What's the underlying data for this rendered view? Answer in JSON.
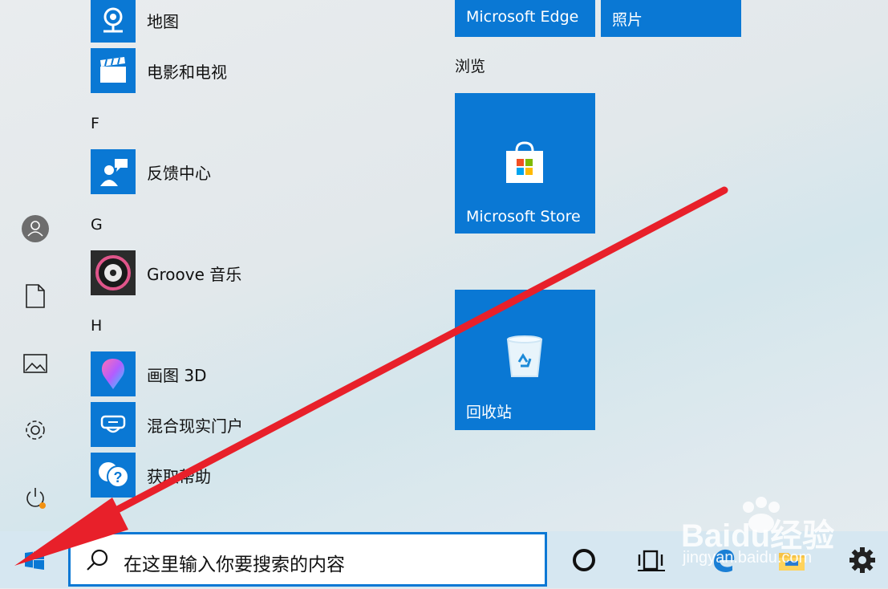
{
  "app_list": {
    "items": [
      {
        "label": "地图",
        "icon": "maps-icon"
      },
      {
        "label": "电影和电视",
        "icon": "movies-tv-icon"
      },
      {
        "label": "反馈中心",
        "icon": "feedback-hub-icon"
      },
      {
        "label": "Groove 音乐",
        "icon": "groove-music-icon"
      },
      {
        "label": "画图 3D",
        "icon": "paint-3d-icon"
      },
      {
        "label": "混合现实门户",
        "icon": "mixed-reality-icon"
      },
      {
        "label": "获取帮助",
        "icon": "get-help-icon"
      }
    ],
    "letters": [
      "F",
      "G",
      "H"
    ]
  },
  "tiles": {
    "edge_label": "Microsoft Edge",
    "photos_label": "照片",
    "group_title": "浏览",
    "store_label": "Microsoft Store",
    "recycle_label": "回收站"
  },
  "taskbar": {
    "search_placeholder": "在这里输入你要搜索的内容"
  },
  "watermark": {
    "brand": "Baidu经验",
    "url": "jingyan.baidu.com"
  },
  "colors": {
    "tile_blue": "#0a78d4",
    "arrow_red": "#e8202a",
    "taskbar": "#d6e7f1"
  }
}
